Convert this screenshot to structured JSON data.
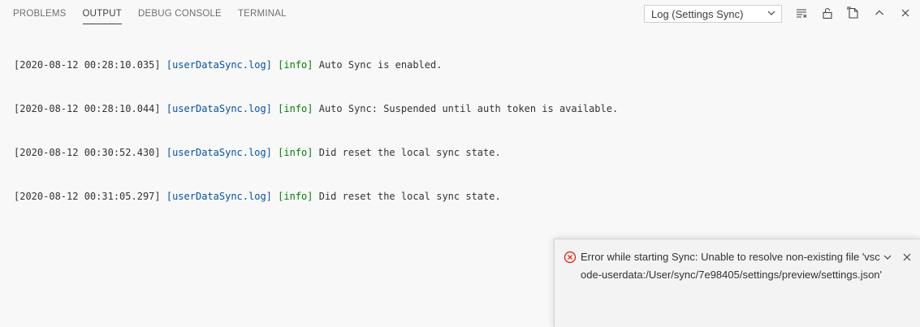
{
  "panel": {
    "tabs": [
      {
        "label": "PROBLEMS",
        "active": false
      },
      {
        "label": "OUTPUT",
        "active": true
      },
      {
        "label": "DEBUG CONSOLE",
        "active": false
      },
      {
        "label": "TERMINAL",
        "active": false
      }
    ],
    "channel_select": {
      "value": "Log (Settings Sync)"
    },
    "toolbar": {
      "icons": [
        "clear-output-icon",
        "lock-scroll-icon",
        "open-log-file-icon",
        "maximize-panel-icon",
        "close-panel-icon"
      ]
    }
  },
  "log_lines": [
    {
      "timestamp": "[2020-08-12 00:28:10.035]",
      "file": "[userDataSync.log]",
      "level": "[info]",
      "message": "Auto Sync is enabled."
    },
    {
      "timestamp": "[2020-08-12 00:28:10.044]",
      "file": "[userDataSync.log]",
      "level": "[info]",
      "message": "Auto Sync: Suspended until auth token is available."
    },
    {
      "timestamp": "[2020-08-12 00:30:52.430]",
      "file": "[userDataSync.log]",
      "level": "[info]",
      "message": "Did reset the local sync state."
    },
    {
      "timestamp": "[2020-08-12 00:31:05.297]",
      "file": "[userDataSync.log]",
      "level": "[info]",
      "message": "Did reset the local sync state."
    }
  ],
  "notification": {
    "type": "error",
    "message": "Error while starting Sync: Unable to resolve non-existing file 'vscode-userdata:/User/sync/7e98405/settings/preview/settings.json'",
    "icons": [
      "error-icon",
      "collapse-icon",
      "close-icon"
    ]
  },
  "colors": {
    "log_file": "#0451a5",
    "log_level": "#008000",
    "error": "#e51400",
    "active_tab_border": "#424242",
    "panel_background": "#f8f8f8"
  }
}
